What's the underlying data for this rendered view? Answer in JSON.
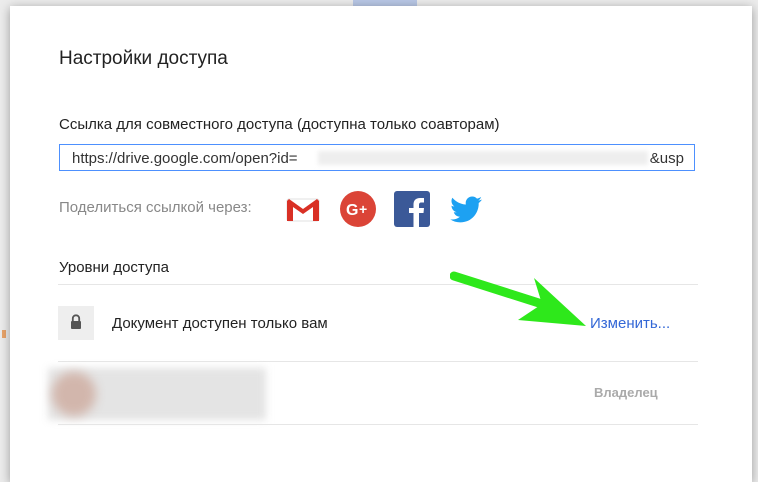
{
  "dialog": {
    "title": "Настройки доступа",
    "link_label": "Ссылка для совместного доступа (доступна только соавторам)",
    "link_value_prefix": "https://drive.google.com/open?id=",
    "link_value_suffix": "&usp",
    "share_label": "Поделиться ссылкой через:",
    "share_services": [
      {
        "icon": "gmail-icon"
      },
      {
        "icon": "google-plus-icon"
      },
      {
        "icon": "facebook-icon"
      },
      {
        "icon": "twitter-icon"
      }
    ],
    "access_section_label": "Уровни доступа",
    "access_row": {
      "icon": "lock-icon",
      "text": "Документ доступен только вам",
      "change_label": "Изменить..."
    },
    "owner_row": {
      "role": "Владелец"
    }
  },
  "colors": {
    "link_border": "#4d90fe",
    "change_link": "#3367d6",
    "gmail_red": "#d93025",
    "gplus_red": "#db4437",
    "facebook_blue": "#3b5998",
    "twitter_blue": "#1da1f2",
    "annotation_arrow": "#2ee81b"
  }
}
